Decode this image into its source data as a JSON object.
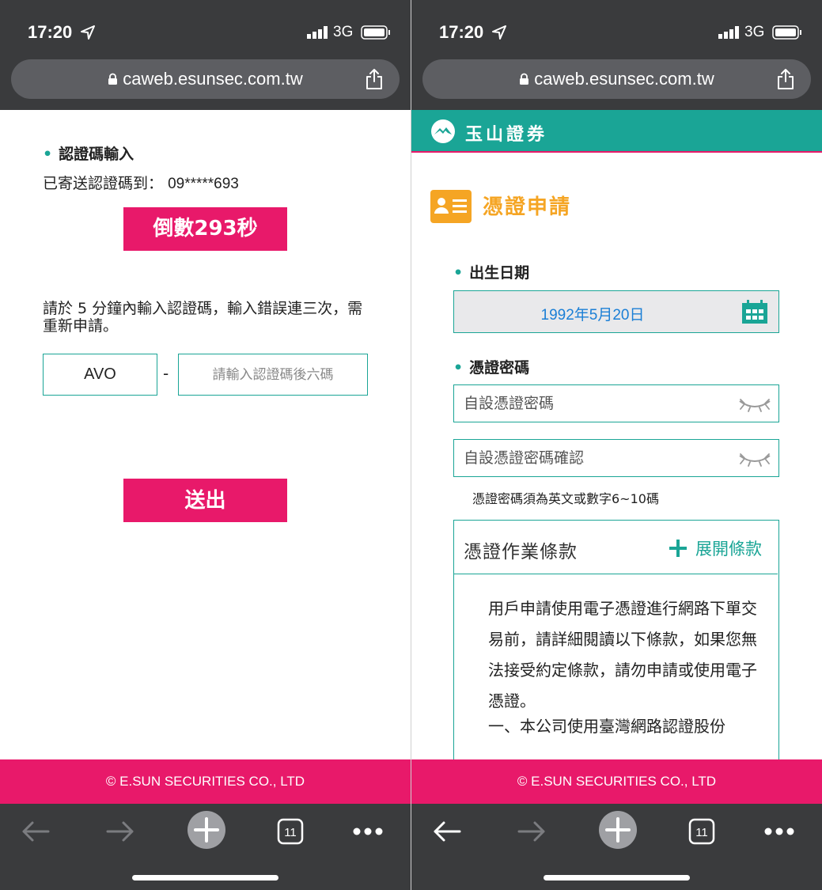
{
  "status_bar": {
    "time": "17:20",
    "network": "3G"
  },
  "browser": {
    "url": "caweb.esunsec.com.tw",
    "tab_count": "11"
  },
  "footer": {
    "copyright": "© E.SUN SECURITIES CO., LTD"
  },
  "left_page": {
    "section_title": "認證碼輸入",
    "sent_to_label": "已寄送認證碼到：",
    "phone_masked": "09*****693",
    "countdown": "倒數293秒",
    "notice": "請於 5 分鐘內輸入認證碼，輸入錯誤連三次，需重新申請。",
    "code_prefix": "AVO",
    "separator": "-",
    "code_placeholder": "請輸入認證碼後六碼",
    "submit_label": "送出"
  },
  "right_page": {
    "brand_name": "玉山證券",
    "page_title": "憑證申請",
    "birthdate_label": "出生日期",
    "birthdate_value": "1992年5月20日",
    "password_label": "憑證密碼",
    "password_placeholder": "自設憑證密碼",
    "password_confirm_placeholder": "自設憑證密碼確認",
    "password_hint": "憑證密碼須為英文或數字6~10碼",
    "terms_title": "憑證作業條款",
    "terms_expand": "展開條款",
    "terms_text": "用戶申請使用電子憑證進行網路下單交易前，請詳細閱讀以下條款，如果您無法接受約定條款，請勿申請或使用電子憑證。",
    "terms_more": "一、本公司使用臺灣網路認證股份"
  },
  "colors": {
    "brand_teal": "#1aa596",
    "brand_pink": "#e8196a",
    "title_orange": "#f5a524",
    "date_blue": "#1b7fd6",
    "chrome_dark": "#3a3b3d"
  }
}
